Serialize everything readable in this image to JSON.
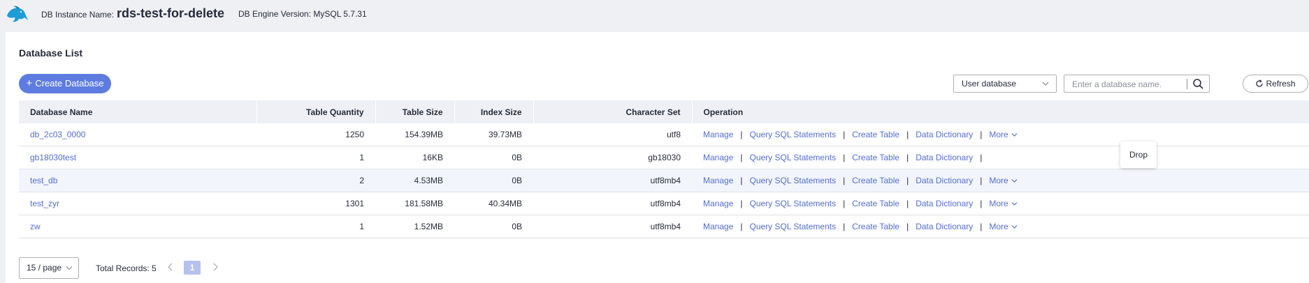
{
  "header": {
    "instance_label": "DB Instance Name:",
    "instance_name": "rds-test-for-delete",
    "engine_label": "DB Engine Version: MySQL 5.7.31"
  },
  "section": {
    "title": "Database List"
  },
  "toolbar": {
    "create_label": "Create Database",
    "filter_value": "User database",
    "search_placeholder": "Enter a database name.",
    "refresh_label": "Refresh"
  },
  "table": {
    "columns": [
      "Database Name",
      "Table Quantity",
      "Table Size",
      "Index Size",
      "Character Set",
      "Operation"
    ],
    "rows": [
      {
        "name": "db_2c03_0000",
        "table_quantity": "1250",
        "table_size": "154.39MB",
        "index_size": "39.73MB",
        "charset": "utf8"
      },
      {
        "name": "gb18030test",
        "table_quantity": "1",
        "table_size": "16KB",
        "index_size": "0B",
        "charset": "gb18030"
      },
      {
        "name": "test_db",
        "table_quantity": "2",
        "table_size": "4.53MB",
        "index_size": "0B",
        "charset": "utf8mb4"
      },
      {
        "name": "test_zyr",
        "table_quantity": "1301",
        "table_size": "181.58MB",
        "index_size": "40.34MB",
        "charset": "utf8mb4"
      },
      {
        "name": "zw",
        "table_quantity": "1",
        "table_size": "1.52MB",
        "index_size": "0B",
        "charset": "utf8mb4"
      }
    ],
    "ops": {
      "manage": "Manage",
      "query": "Query SQL Statements",
      "create_table": "Create Table",
      "dictionary": "Data Dictionary",
      "more": "More",
      "sep": "|"
    },
    "more_menu": {
      "drop": "Drop"
    }
  },
  "pagination": {
    "page_size": "15 / page",
    "total_label": "Total Records: 5",
    "current_page": "1"
  },
  "colors": {
    "primary": "#5e7ce0",
    "link": "#526ecc",
    "page_bg": "#eff0f4",
    "header_bg": "#eef0f5",
    "row_highlight": "#f2f5fc",
    "page_active": "#b5c2ee"
  }
}
